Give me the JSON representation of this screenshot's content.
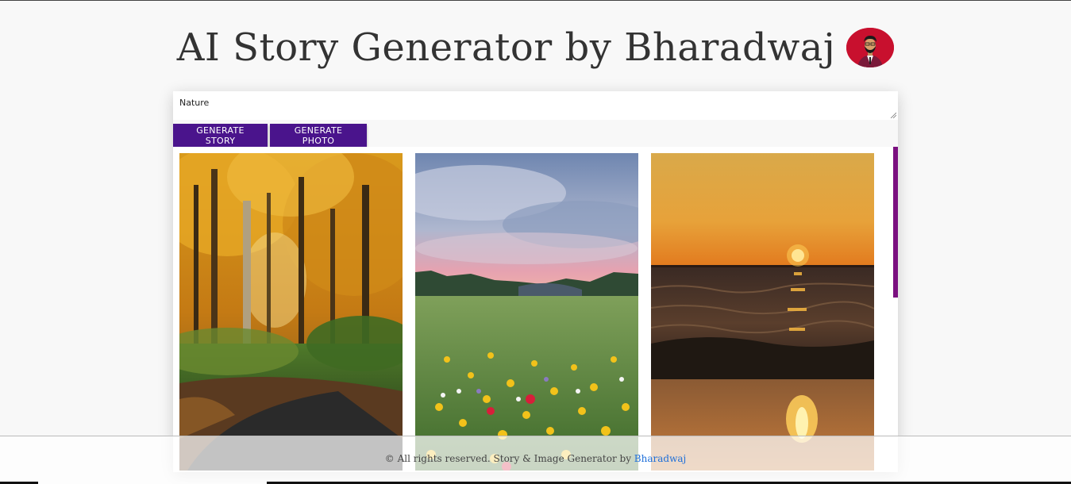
{
  "header": {
    "title": "AI Story Generator by Bharadwaj",
    "avatar_icon": "user-avatar-icon"
  },
  "prompt": {
    "value": "Nature",
    "placeholder": ""
  },
  "buttons": {
    "generate_story": "GENERATE STORY",
    "generate_photo": "GENERATE PHOTO"
  },
  "gallery": {
    "images": [
      {
        "icon": "autumn-forest-photo"
      },
      {
        "icon": "wildflower-meadow-photo"
      },
      {
        "icon": "sunset-sea-photo"
      }
    ]
  },
  "footer": {
    "text": "© All rights reserved. Story & Image Generator by ",
    "link": "Bharadwaj"
  },
  "colors": {
    "button_bg": "#4a148c",
    "scrollbar": "#7b1080",
    "avatar_bg": "#c8102e",
    "link": "#1e6fd9"
  }
}
